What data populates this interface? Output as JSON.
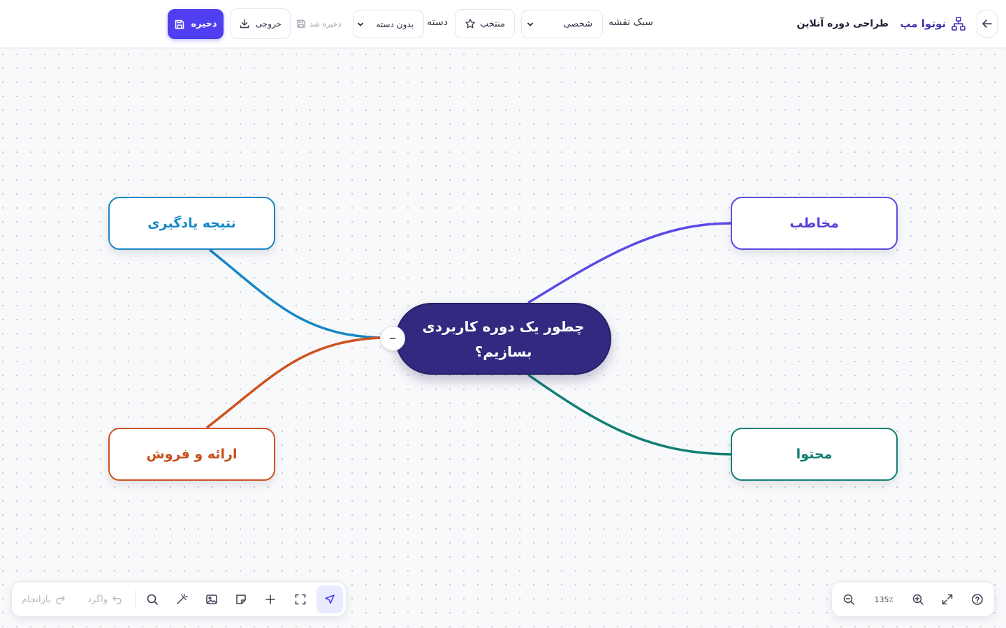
{
  "header": {
    "brand_name": "نوتوا مپ",
    "map_title": "طراحی دوره آنلاین",
    "style_label": "سبک نقشه",
    "style_value": "شخصی",
    "favorite_label": "منتخب",
    "category_label": "دسته",
    "category_value": "بدون دسته",
    "saved_status": "ذخیره شد",
    "export_label": "خروجی",
    "save_label": "ذخیره"
  },
  "mindmap": {
    "center_line1": "چطور یک دوره کاربردی",
    "center_line2": "بسازیم؟",
    "nodes": {
      "audience": "مخاطب",
      "content": "محتوا",
      "result": "نتیجه یادگیری",
      "sales": "ارائه و فروش"
    },
    "colors": {
      "audience": "#5b4ae6",
      "content": "#127f74",
      "result": "#1787c4",
      "sales": "#cf5220",
      "center": "#312a80",
      "accent": "#4f3ff0"
    }
  },
  "toolbar": {
    "redo_label": "بازانجام",
    "undo_label": "واگرد",
    "zoom_level": "135٪"
  }
}
